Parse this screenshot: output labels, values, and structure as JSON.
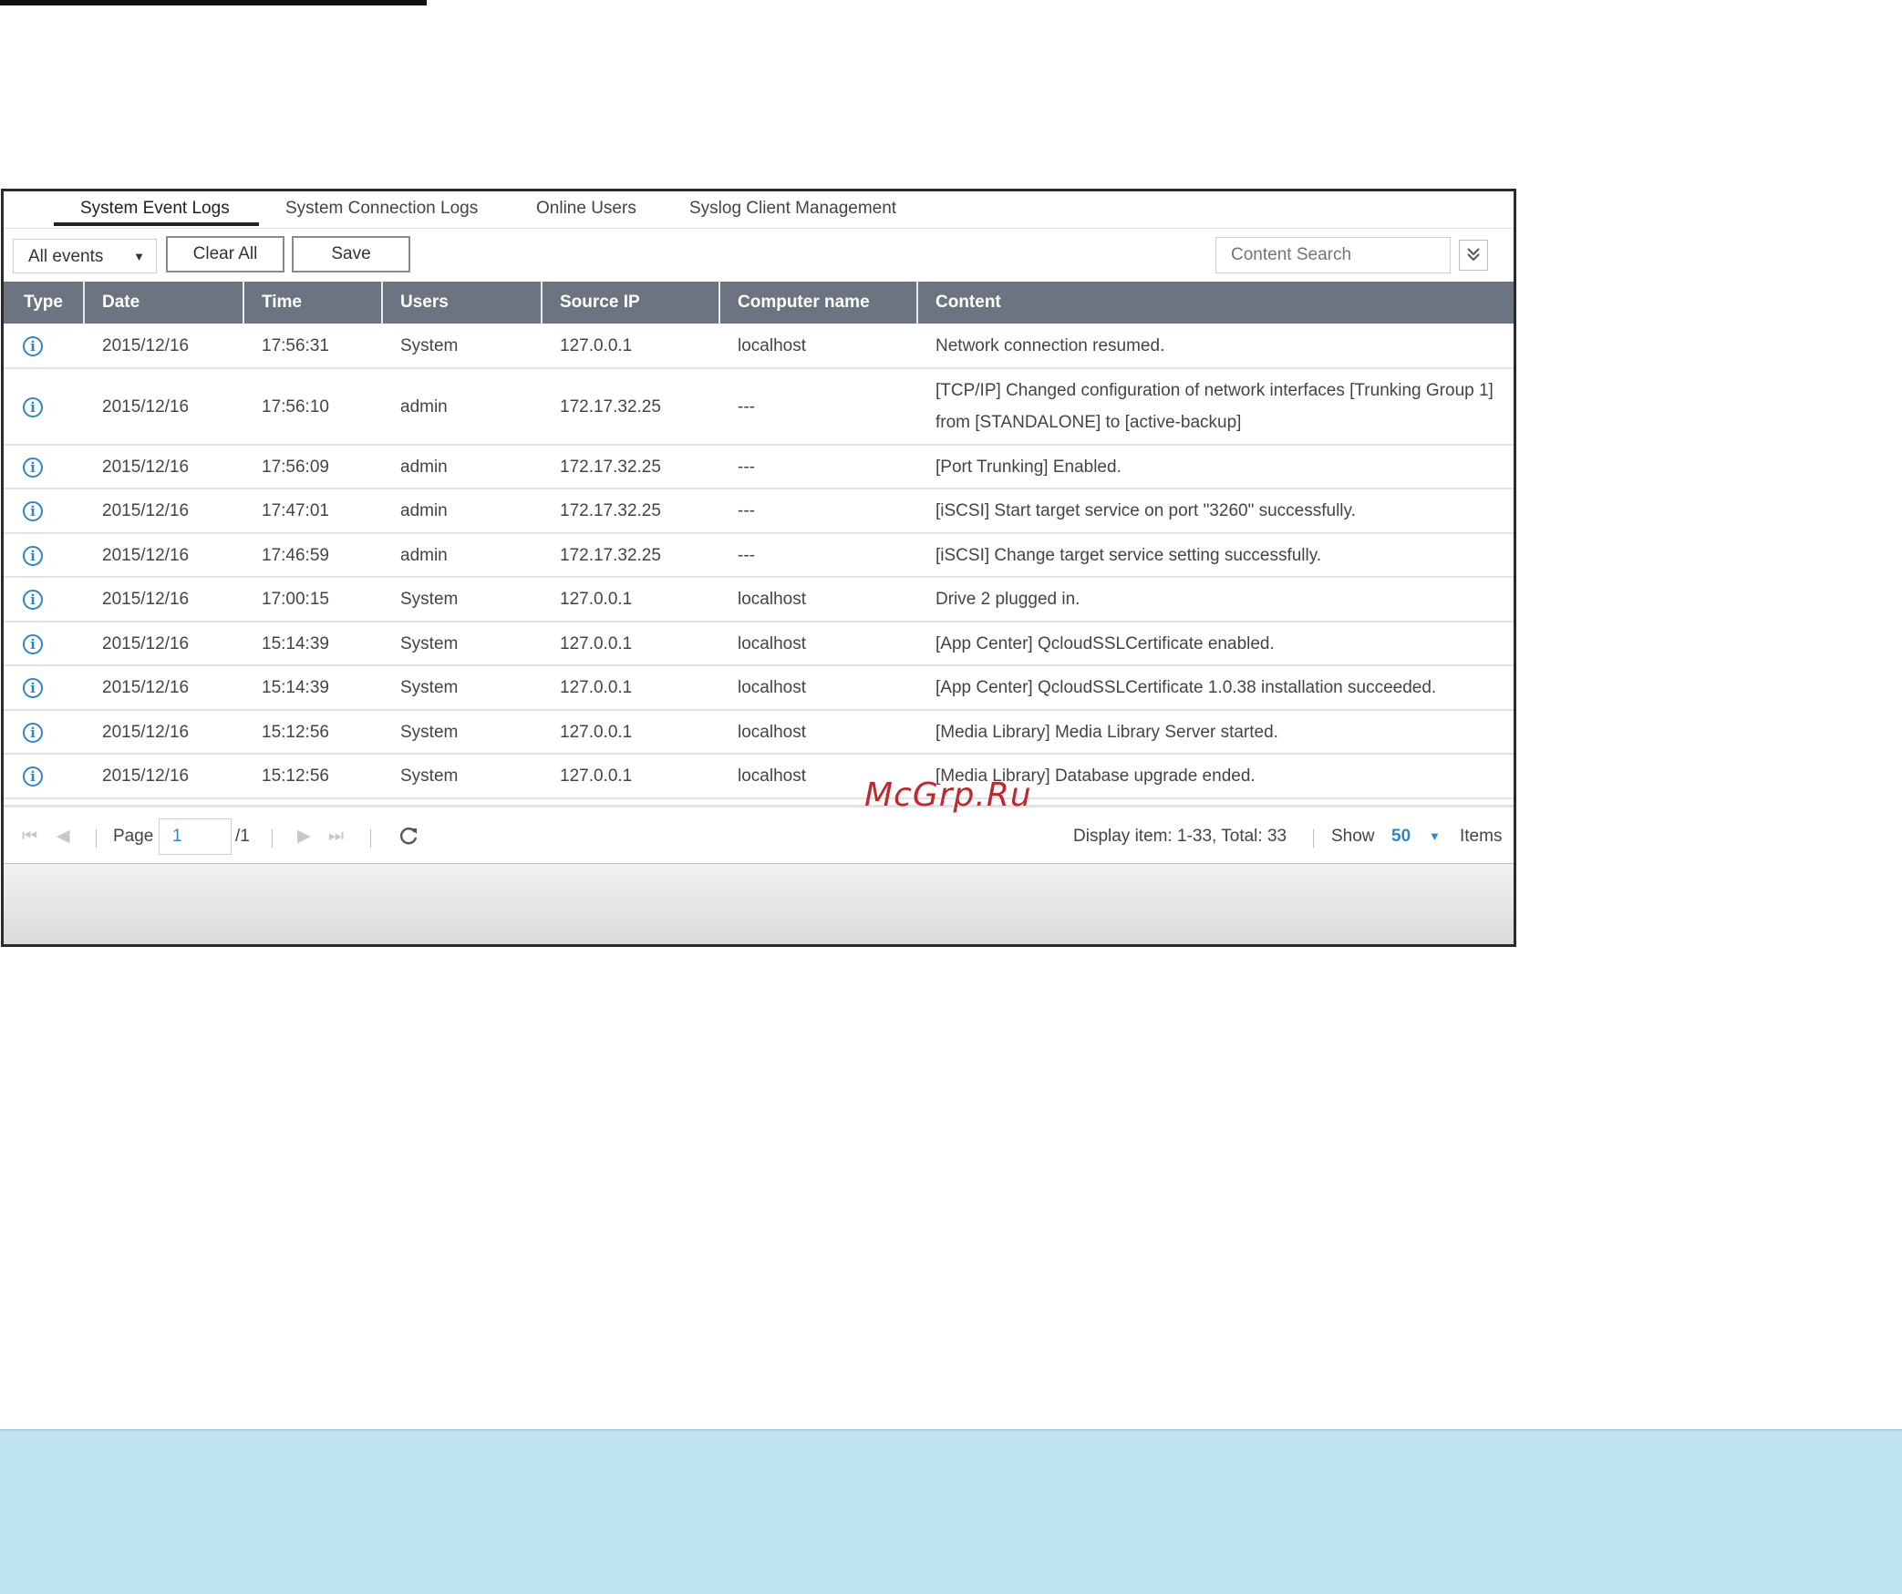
{
  "tabs": [
    {
      "label": "System Event Logs",
      "active": true
    },
    {
      "label": "System Connection Logs",
      "active": false
    },
    {
      "label": "Online Users",
      "active": false
    },
    {
      "label": "Syslog Client Management",
      "active": false
    }
  ],
  "toolbar": {
    "filter_value": "All events",
    "clear_all_label": "Clear All",
    "save_label": "Save",
    "search_placeholder": "Content Search"
  },
  "table": {
    "columns": [
      "Type",
      "Date",
      "Time",
      "Users",
      "Source IP",
      "Computer name",
      "Content"
    ],
    "rows": [
      {
        "type": "info",
        "date": "2015/12/16",
        "time": "17:56:31",
        "user": "System",
        "ip": "127.0.0.1",
        "computer": "localhost",
        "content": "Network connection resumed."
      },
      {
        "type": "info",
        "date": "2015/12/16",
        "time": "17:56:10",
        "user": "admin",
        "ip": "172.17.32.25",
        "computer": "---",
        "content": "[TCP/IP] Changed configuration of network interfaces [Trunking Group 1] from [STANDALONE] to [active-backup]"
      },
      {
        "type": "info",
        "date": "2015/12/16",
        "time": "17:56:09",
        "user": "admin",
        "ip": "172.17.32.25",
        "computer": "---",
        "content": "[Port Trunking] Enabled."
      },
      {
        "type": "info",
        "date": "2015/12/16",
        "time": "17:47:01",
        "user": "admin",
        "ip": "172.17.32.25",
        "computer": "---",
        "content": "[iSCSI] Start target service on port \"3260\" successfully."
      },
      {
        "type": "info",
        "date": "2015/12/16",
        "time": "17:46:59",
        "user": "admin",
        "ip": "172.17.32.25",
        "computer": "---",
        "content": "[iSCSI] Change target service setting successfully."
      },
      {
        "type": "info",
        "date": "2015/12/16",
        "time": "17:00:15",
        "user": "System",
        "ip": "127.0.0.1",
        "computer": "localhost",
        "content": "Drive 2 plugged in."
      },
      {
        "type": "info",
        "date": "2015/12/16",
        "time": "15:14:39",
        "user": "System",
        "ip": "127.0.0.1",
        "computer": "localhost",
        "content": "[App Center] QcloudSSLCertificate enabled."
      },
      {
        "type": "info",
        "date": "2015/12/16",
        "time": "15:14:39",
        "user": "System",
        "ip": "127.0.0.1",
        "computer": "localhost",
        "content": "[App Center] QcloudSSLCertificate 1.0.38 installation succeeded."
      },
      {
        "type": "info",
        "date": "2015/12/16",
        "time": "15:12:56",
        "user": "System",
        "ip": "127.0.0.1",
        "computer": "localhost",
        "content": "[Media Library] Media Library Server started."
      },
      {
        "type": "info",
        "date": "2015/12/16",
        "time": "15:12:56",
        "user": "System",
        "ip": "127.0.0.1",
        "computer": "localhost",
        "content": "[Media Library] Database upgrade ended."
      }
    ]
  },
  "pagination": {
    "page_label": "Page",
    "page_value": "1",
    "page_total": "/1",
    "display_text": "Display item: 1-33, Total: 33",
    "show_label": "Show",
    "show_value": "50",
    "items_label": "Items"
  },
  "watermark": "McGrp.Ru",
  "colors": {
    "header_bg": "#6d7481",
    "accent_blue": "#2f86c8",
    "note_bg": "#c1e4f3"
  },
  "icons": {
    "row_type": "info-icon",
    "refresh": "refresh-icon",
    "search_toggle": "double-chevron-down-icon"
  }
}
